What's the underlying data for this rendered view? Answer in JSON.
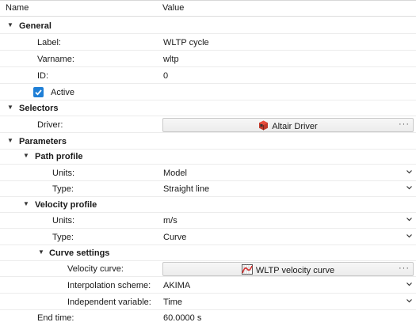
{
  "header": {
    "name": "Name",
    "value": "Value"
  },
  "general": {
    "title": "General",
    "label_name": "Label:",
    "label_value": "WLTP cycle",
    "varname_name": "Varname:",
    "varname_value": "wltp",
    "id_name": "ID:",
    "id_value": "0",
    "active_label": "Active",
    "active_checked": true
  },
  "selectors": {
    "title": "Selectors",
    "driver_name": "Driver:",
    "driver_value": "Altair Driver"
  },
  "parameters": {
    "title": "Parameters",
    "path_profile": {
      "title": "Path profile",
      "units_name": "Units:",
      "units_value": "Model",
      "type_name": "Type:",
      "type_value": "Straight line"
    },
    "velocity_profile": {
      "title": "Velocity profile",
      "units_name": "Units:",
      "units_value": "m/s",
      "type_name": "Type:",
      "type_value": "Curve",
      "curve_settings": {
        "title": "Curve settings",
        "velocity_curve_name": "Velocity curve:",
        "velocity_curve_value": "WLTP velocity curve",
        "interp_name": "Interpolation scheme:",
        "interp_value": "AKIMA",
        "indep_name": "Independent variable:",
        "indep_value": "Time"
      }
    },
    "end_time_name": "End time:",
    "end_time_value": "60.0000 s"
  },
  "colors": {
    "accent": "#1f7fd6"
  },
  "icons": {
    "expand": "caret-down-icon",
    "dropdown": "chevron-down-icon",
    "more": "ellipsis-icon",
    "driver": "driver-cube-icon",
    "curve": "curve-plot-icon"
  }
}
